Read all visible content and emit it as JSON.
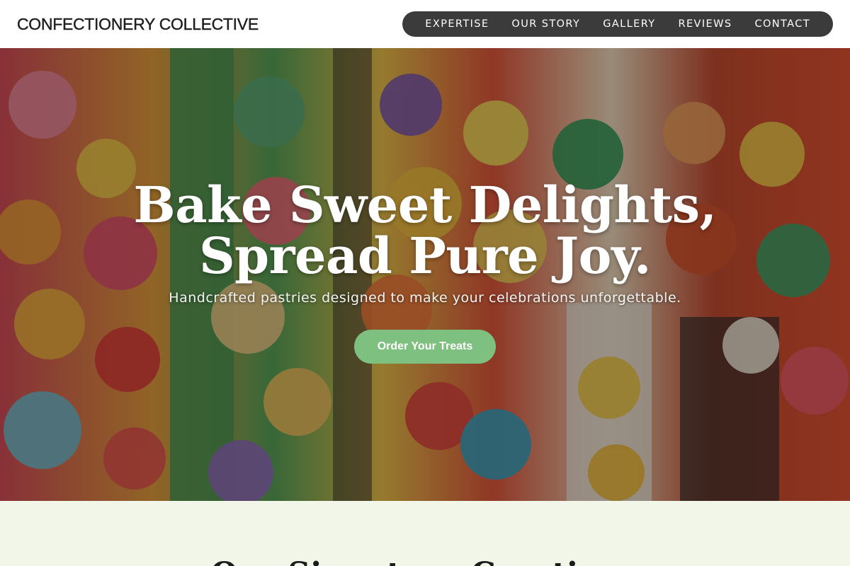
{
  "header": {
    "brand": "CONFECTIONERY COLLECTIVE",
    "nav": [
      {
        "label": "EXPERTISE"
      },
      {
        "label": "OUR STORY"
      },
      {
        "label": "GALLERY"
      },
      {
        "label": "REVIEWS"
      },
      {
        "label": "CONTACT"
      }
    ]
  },
  "hero": {
    "title_line1": "Bake Sweet Delights,",
    "title_line2": "Spread Pure Joy.",
    "subtitle": "Handcrafted pastries designed to make your celebrations unforgettable.",
    "cta_label": "Order Your Treats"
  },
  "signature": {
    "heading": "Our Signature Creations"
  },
  "colors": {
    "nav_bg": "#3b3b3b",
    "cta": "#7ec07f",
    "section_bg": "#f2f6e8"
  }
}
